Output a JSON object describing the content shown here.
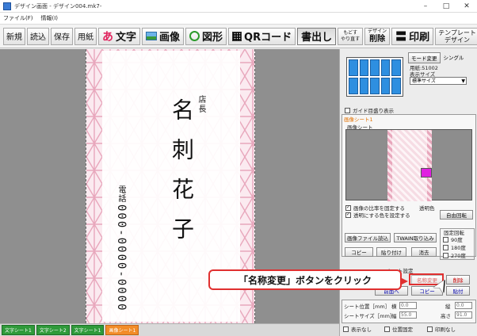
{
  "window": {
    "title": "デザイン画面 - デザイン004.mk7-",
    "minimize": "–",
    "maximize": "□",
    "close": "✕"
  },
  "menu": [
    "ファイル(F)",
    "情報(I)"
  ],
  "toolbar": {
    "new": "新規",
    "open": "読込",
    "save": "保存",
    "paper": "用紙",
    "text": "文字",
    "image": "画像",
    "shape": "図形",
    "qr": "QRコード",
    "vertical": "書出し",
    "undo_top": "もどす",
    "undo_bottom": "やり直す",
    "delete_top": "デザイン",
    "delete_bottom": "削除",
    "print": "印刷",
    "template_top": "テンプレート",
    "template_bottom": "デザイン"
  },
  "card": {
    "title": "店長",
    "name": "名刺花子",
    "phone_label": "電話",
    "phone": "000-0000-0000",
    "pattern_color": "#e8a7bc"
  },
  "status_tabs": [
    "文字シート1",
    "文字シート2",
    "文字シート1",
    "画像シート1"
  ],
  "right_panel": {
    "mode_change": "モード変更",
    "mode_simple": "シングル",
    "paper_label": "用紙:51002",
    "display_size_label": "表示サイズ",
    "display_size_value": "標準サイズ",
    "guide_checkbox": "ガイド目盛り表示",
    "group_title": "画像シート1",
    "image_sheet_label": "画像シート",
    "transparent_color_label": "透明色",
    "check_fix_ratio": "画像の比率を固定する",
    "check_transparent": "透明にする色を設定する",
    "free_rotate": "自由回転",
    "fixed_rotate": "固定回転",
    "rot_90": "90度",
    "rot_180": "180度",
    "rot_270": "270度",
    "load_image": "画像ファイル読込",
    "twain": "TWAIN取り込み",
    "copy": "コピー",
    "paste": "貼り付け",
    "erase": "消去",
    "sheet_settings": "シート設定",
    "rename": "名称変更",
    "delete": "削除",
    "front": "前面へ",
    "copy2": "コピー",
    "paste2": "貼付",
    "sheet_pos": "シート位置［mm］",
    "horizontal": "横",
    "sheet_size": "シートサイズ［mm］",
    "width": "幅",
    "vertical": "縦",
    "height": "高さ",
    "hide": "表示なし",
    "pos_fixed": "位置固定",
    "no_print": "印刷なし",
    "val_x": "0.0",
    "val_y": "0.0",
    "val_w": "55.0",
    "val_h": "91.0",
    "transparent_color": "#e020e0"
  },
  "callout": {
    "text": "「名称変更」ボタンをクリック",
    "color": "#e03030"
  }
}
